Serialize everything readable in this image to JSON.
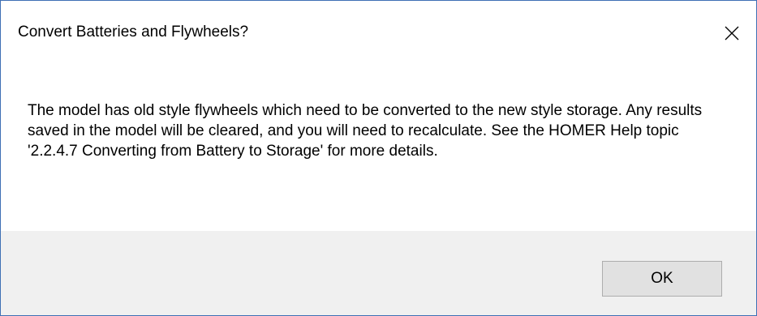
{
  "dialog": {
    "title": "Convert Batteries and Flywheels?",
    "close_icon": "close-icon",
    "message": "The model has old style flywheels which need to be converted to the new style storage. Any results saved in the model will be cleared, and you will need to recalculate. See the HOMER Help topic '2.2.4.7 Converting from Battery to Storage' for more details.",
    "ok_label": "OK"
  },
  "colors": {
    "window_border": "#3f70b5",
    "footer_background": "#f0f0f0",
    "button_background": "#e1e1e1",
    "button_border": "#adadad"
  }
}
